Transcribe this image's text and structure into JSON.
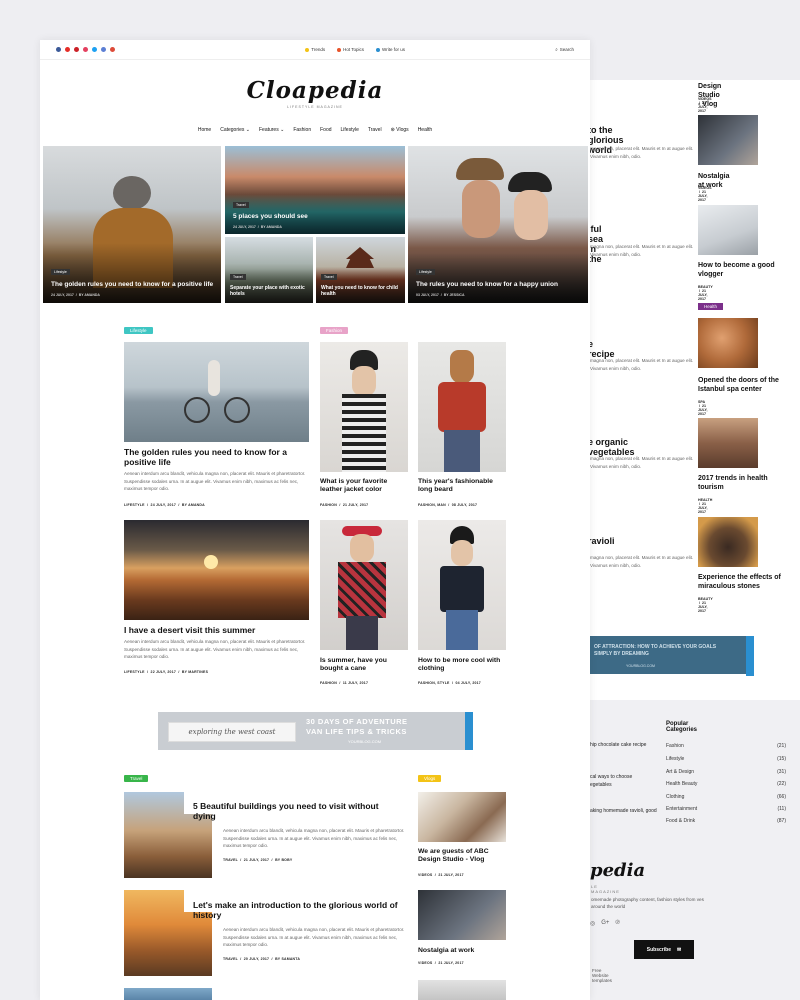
{
  "topbar": {
    "links": [
      "Trends",
      "Hot Topics",
      "Write for us"
    ],
    "search": "Search"
  },
  "logo": {
    "name": "Cloapedia",
    "tagline": "LIFESTYLE MAGAZINE"
  },
  "nav": [
    "Home",
    "Categories",
    "Features",
    "Fashion",
    "Food",
    "Lifestyle",
    "Travel",
    "Vlogs",
    "Health"
  ],
  "hero": [
    {
      "tag": "Lifestyle",
      "title": "The golden rules you need to know for a positive life",
      "date": "24 JULY, 2017",
      "author": "BY AMANDA"
    },
    {
      "tag": "Travel",
      "title": "5 places you should see",
      "date": "24 JULY, 2017",
      "author": "BY AMANDA"
    },
    {
      "tag": "Travel",
      "title": "Separate your place with exotic hotels"
    },
    {
      "tag": "Travel",
      "title": "What you need to know for child health"
    },
    {
      "tag": "Lifestyle",
      "title": "The rules you need to know for a happy union",
      "date": "03 JULY, 2017",
      "author": "BY JESSICA"
    }
  ],
  "sections": {
    "lifestyle": "Lifestyle",
    "fashion": "Fashion",
    "travel": "Travel",
    "vlogs": "Vlogs"
  },
  "excerpt": "Aenean interdum arcu blandit, vehicula magna non, placerat elit. Mauris et pharetratortor. Suspendisse sodales urna. In at augue elit. Vivamus enim nibh, maximus ac felis nec, maximus tempor odio.",
  "lifestyle_posts": [
    {
      "title": "The golden rules you need to know for a positive life",
      "cat": "LIFESTYLE",
      "date": "24 JULY, 2017",
      "author": "BY AMANDA"
    },
    {
      "title": "I have a desert visit this summer",
      "cat": "LIFESTYLE",
      "date": "22 JULY, 2017",
      "author": "BY MARTINES"
    }
  ],
  "fashion_posts": [
    {
      "title": "What is your favorite leather jacket color",
      "cat": "FASHION",
      "date": "21 JULY, 2017"
    },
    {
      "title": "This year's fashionable long beard",
      "cat": "FASHION, MAN",
      "date": "08 JULY, 2017"
    },
    {
      "title": "Is summer, have you bought a cane",
      "cat": "FASHION",
      "date": "11 JULY, 2017"
    },
    {
      "title": "How to be more cool with clothing",
      "cat": "FASHION, STYLE",
      "date": "04 JULY, 2017"
    }
  ],
  "banner": {
    "script": "exploring the west coast",
    "line1": "30 DAYS OF ADVENTURE",
    "line2": "VAN LIFE TIPS & TRICKS",
    "site": "YOURBLOG.COM",
    "ad": "ADVERTISING"
  },
  "travel_posts": [
    {
      "title": "5 Beautiful buildings you need to visit without dying",
      "cat": "TRAVEL",
      "date": "21 JULY, 2017",
      "author": "BY BOBY"
    },
    {
      "title": "Let's make an introduction to the glorious world of history",
      "cat": "TRAVEL",
      "date": "20 JULY, 2017",
      "author": "BY SAMANTA"
    }
  ],
  "vlog_posts": [
    {
      "title": "We are guests of ABC Design Studio - Vlog",
      "cat": "VIDEOS",
      "date": "21 JULY, 2017"
    },
    {
      "title": "Nostalgia at work",
      "cat": "VIDEOS",
      "date": "21 JULY, 2017"
    }
  ],
  "back_side": [
    {
      "title": "Design Studio - Vlog",
      "cat": "VIDEOS",
      "date": "21 JULY, 2017"
    },
    {
      "title": "Nostalgia at work",
      "cat": "VIDEOS",
      "date": "21 JULY, 2017"
    },
    {
      "title": "How to become a good vlogger",
      "cat": "BEAUTY",
      "date": "21 JULY, 2017"
    },
    {
      "title": "Opened the doors of the Istanbul spa center",
      "cat": "SPA",
      "date": "21 JULY, 2017"
    },
    {
      "title": "2017 trends in health tourism",
      "cat": "HEALTH",
      "date": "21 JULY, 2017"
    },
    {
      "title": "Experience the effects of miraculous stones",
      "cat": "BEAUTY",
      "date": "21 JULY, 2017"
    }
  ],
  "health_tag": "Health",
  "back_titles": [
    "to the glorious world",
    "iful sea in the",
    "e recipe",
    "e organic vegetables",
    "ravioli"
  ],
  "back_excerpt": "magna non, placerat elit. Mauris et In at augue elit. Vivamus enim nibh, odio.",
  "back_banner": {
    "line": "OF ATTRACTION: HOW TO ACHIEVE YOUR GOALS SIMPLY BY DREAMING",
    "site": "YOURBLOG.COM",
    "ad": "ADVERTISING"
  },
  "popular": {
    "title": "Popular Categories",
    "items": [
      {
        "name": "Fashion",
        "count": "(21)"
      },
      {
        "name": "Lifestyle",
        "count": "(15)"
      },
      {
        "name": "Art & Design",
        "count": "(31)"
      },
      {
        "name": "Health Beauty",
        "count": "(22)"
      },
      {
        "name": "Clothing",
        "count": "(66)"
      },
      {
        "name": "Entertainment",
        "count": "(11)"
      },
      {
        "name": "Food & Drink",
        "count": "(87)"
      }
    ]
  },
  "footer_posts": [
    "hip chocolate cake recipe",
    "cal ways to choose egetables",
    "aking homemade ravioli, good"
  ],
  "footer": {
    "logo": "pedia",
    "tagline": "LE MAGAZINE",
    "about": "omemade photography content, fashion styles from ves around the world",
    "subscribe": "Subscribe",
    "copy": "Free Website templates"
  },
  "colors": {
    "lifestyle": "#3fc6c3",
    "fashion": "#e8a3c8",
    "travel": "#38b54a",
    "vlogs": "#f3c316",
    "health": "#7b2f8a"
  }
}
